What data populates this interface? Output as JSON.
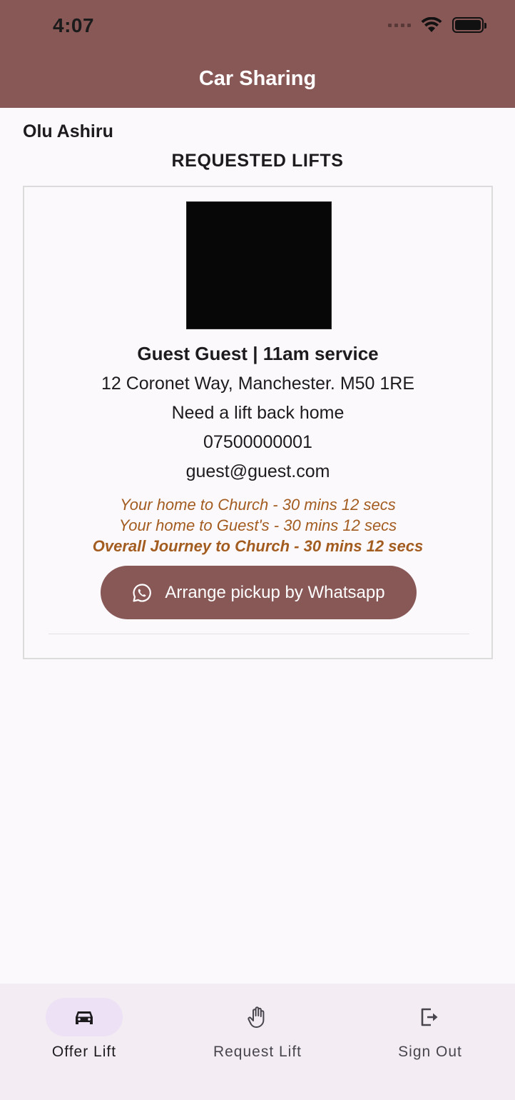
{
  "status_bar": {
    "time": "4:07"
  },
  "header": {
    "title": "Car Sharing"
  },
  "main": {
    "user_name": "Olu Ashiru",
    "section_title": "REQUESTED LIFTS"
  },
  "lift_card": {
    "guest_line": "Guest Guest | 11am service",
    "address": "12 Coronet Way, Manchester. M50 1RE",
    "note": "Need a lift back home",
    "phone": "07500000001",
    "email": "guest@guest.com",
    "journey_home_to_church": "Your home to Church - 30 mins 12 secs",
    "journey_home_to_guest": "Your home to Guest's - 30 mins 12 secs",
    "journey_overall": "Overall Journey to Church - 30 mins 12 secs",
    "whatsapp_button_label": "Arrange pickup by Whatsapp"
  },
  "bottom_nav": {
    "items": [
      {
        "label": "Offer Lift",
        "icon": "car-icon",
        "active": true
      },
      {
        "label": "Request Lift",
        "icon": "hand-icon",
        "active": false
      },
      {
        "label": "Sign Out",
        "icon": "logout-icon",
        "active": false
      }
    ]
  },
  "colors": {
    "primary": "#885857",
    "background": "#fcf9fc",
    "journey_text": "#a35c20",
    "nav_background": "#f3edf3",
    "active_pill": "#ece1f5"
  }
}
